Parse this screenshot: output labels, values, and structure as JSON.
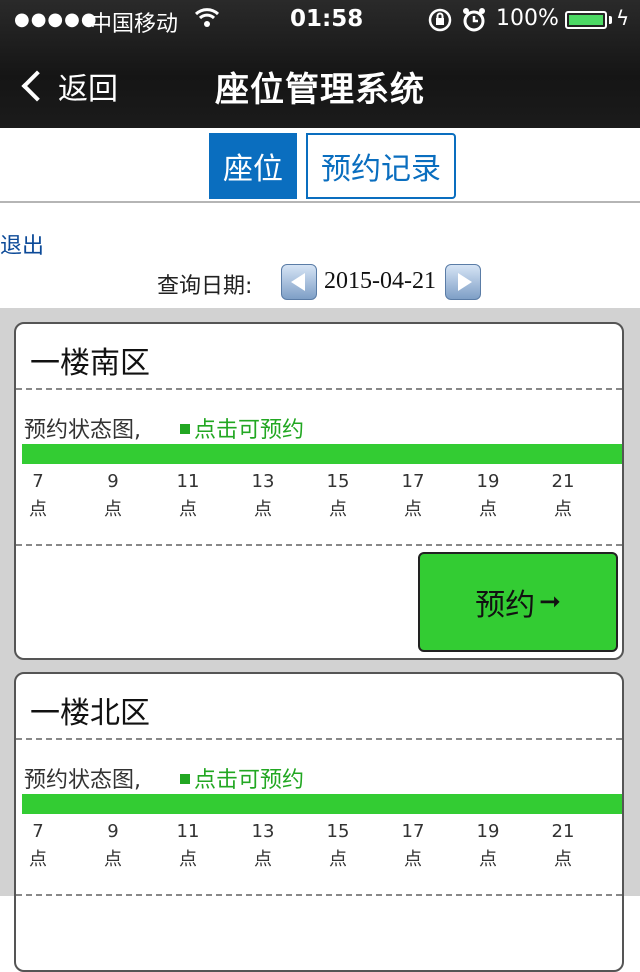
{
  "status_bar": {
    "signal_dots": "●●●●●",
    "carrier": "中国移动",
    "time": "01:58",
    "battery_percent": "100%"
  },
  "nav": {
    "back_label": "返回",
    "title": "座位管理系统"
  },
  "tabs": [
    {
      "label": "座位",
      "active": true
    },
    {
      "label": "预约记录",
      "active": false
    }
  ],
  "logout_label": "退出",
  "date_query": {
    "label": "查询日期:",
    "value": "2015-04-21"
  },
  "areas": [
    {
      "name": "一楼南区",
      "status_label": "预约状态图,",
      "legend_label": "点击可预约",
      "hours": [
        "7",
        "9",
        "11",
        "13",
        "15",
        "17",
        "19",
        "21"
      ],
      "hour_suffix": "点",
      "book_label": "预约"
    },
    {
      "name": "一楼北区",
      "status_label": "预约状态图,",
      "legend_label": "点击可预约",
      "hours": [
        "7",
        "9",
        "11",
        "13",
        "15",
        "17",
        "19",
        "21"
      ],
      "hour_suffix": "点"
    }
  ],
  "colors": {
    "nav_bg": "#1b1b1b",
    "tab_active": "#0a6ebf",
    "available_green": "#33cc33",
    "legend_green": "#22a722",
    "link_blue": "#0c4a98"
  }
}
